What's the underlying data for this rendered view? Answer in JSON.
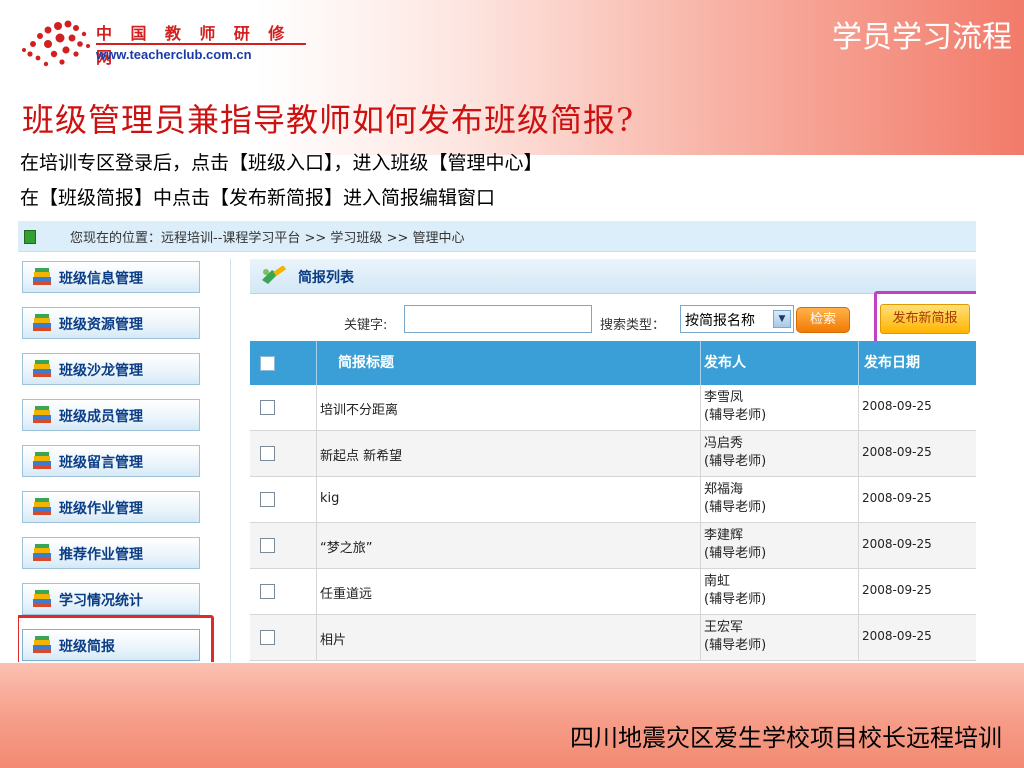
{
  "logo": {
    "cn": "中 国 教 师 研 修 网",
    "url": "www.teacherclub.com.cn"
  },
  "corner_title": "学员学习流程",
  "page_title": "班级管理员兼指导教师如何发布班级简报?",
  "instructions": [
    "在培训专区登录后，点击【班级入口】，进入班级【管理中心】",
    "在【班级简报】中点击【发布新简报】进入简报编辑窗口"
  ],
  "breadcrumb": "您现在的位置：远程培训--课程学习平台 >> 学习班级 >> 管理中心",
  "sidebar": {
    "items": [
      {
        "label": "班级信息管理"
      },
      {
        "label": "班级资源管理"
      },
      {
        "label": "班级沙龙管理"
      },
      {
        "label": "班级成员管理"
      },
      {
        "label": "班级留言管理"
      },
      {
        "label": "班级作业管理"
      },
      {
        "label": "推荐作业管理"
      },
      {
        "label": "学习情况统计"
      },
      {
        "label": "班级简报"
      }
    ],
    "active_index": 8
  },
  "panel": {
    "title": "简报列表",
    "keyword_label": "关键字:",
    "keyword_value": "",
    "type_label": "搜索类型：",
    "type_selected": "按简报名称",
    "search_button": "检索",
    "publish_button": "发布新简报"
  },
  "table": {
    "headers": {
      "title": "简报标题",
      "publisher": "发布人",
      "date": "发布日期"
    },
    "rows": [
      {
        "title": "培训不分距离",
        "publisher": "李雪凤",
        "role": "(辅导老师)",
        "date": "2008-09-25"
      },
      {
        "title": "新起点 新希望",
        "publisher": "冯启秀",
        "role": "(辅导老师)",
        "date": "2008-09-25"
      },
      {
        "title": "kig",
        "publisher": "郑福海",
        "role": "(辅导老师)",
        "date": "2008-09-25"
      },
      {
        "title": "“梦之旅”",
        "publisher": "李建辉",
        "role": "(辅导老师)",
        "date": "2008-09-25"
      },
      {
        "title": "任重道远",
        "publisher": "南虹",
        "role": "(辅导老师)",
        "date": "2008-09-25"
      },
      {
        "title": "相片",
        "publisher": "王宏军",
        "role": "(辅导老师)",
        "date": "2008-09-25"
      }
    ]
  },
  "footer": "四川地震灾区爱生学校项目校长远程培训",
  "colors": {
    "title_red": "#cc1111",
    "table_header": "#3a9fd6",
    "highlight_red": "#e02a2a",
    "highlight_purple": "#c240c2",
    "button_orange": "#f27a05"
  }
}
